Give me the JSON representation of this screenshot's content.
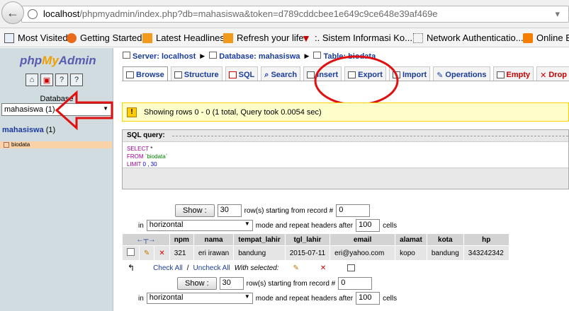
{
  "browser": {
    "url_host": "localhost",
    "url_rest": "/phpmyadmin/index.php?db=mahasiswa&token=d789cddcbee1e649c9ce648e39af469e"
  },
  "bookmarks": [
    "Most Visited",
    "Getting Started",
    "Latest Headlines",
    "Refresh your life",
    ":. Sistem Informasi Ko...",
    "Network Authenticatio...",
    "Online B"
  ],
  "sidebar": {
    "logo_a": "php",
    "logo_b": "My",
    "logo_c": "Admin",
    "database_label": "Database",
    "database_select": "mahasiswa (1)",
    "db_name": "mahasiswa",
    "db_count": "(1)",
    "table_name": "biodata"
  },
  "breadcrumb": {
    "server": "Server: localhost",
    "database": "Database: mahasiswa",
    "table": "Table: biodata"
  },
  "tabs": [
    "Browse",
    "Structure",
    "SQL",
    "Search",
    "Insert",
    "Export",
    "Import",
    "Operations",
    "Empty",
    "Drop"
  ],
  "notice": "Showing rows 0 - 0 (1 total, Query took 0.0054 sec)",
  "sql": {
    "legend": "SQL query:",
    "select_kw": "SELECT",
    "select_rest": " *",
    "from_kw": "FROM",
    "from_table": "`biodata`",
    "limit_kw": "LIMIT",
    "limit_vals": "0 , 30"
  },
  "nav": {
    "show_label": "Show :",
    "rows_value": "30",
    "rows_text": "row(s) starting from record #",
    "record_value": "0",
    "in_label": "in",
    "mode_value": "horizontal",
    "mode_text": "mode and repeat headers after",
    "headers_value": "100",
    "cells_label": "cells"
  },
  "table": {
    "headers": [
      "npm",
      "nama",
      "tempat_lahir",
      "tgl_lahir",
      "email",
      "alamat",
      "kota",
      "hp"
    ],
    "row": [
      "321",
      "eri irawan",
      "bandung",
      "2015-07-11",
      "eri@yahoo.com",
      "kopo",
      "bandung",
      "343242342"
    ]
  },
  "with_selected": {
    "check_all": "Check All",
    "slash": "/",
    "uncheck_all": "Uncheck All",
    "label": "With selected:"
  },
  "colors": {
    "sidebar_bg": "#d0dce0",
    "link": "#1a3d9d",
    "annotation_red": "#e01010",
    "notice_bg": "#ffffcc"
  }
}
